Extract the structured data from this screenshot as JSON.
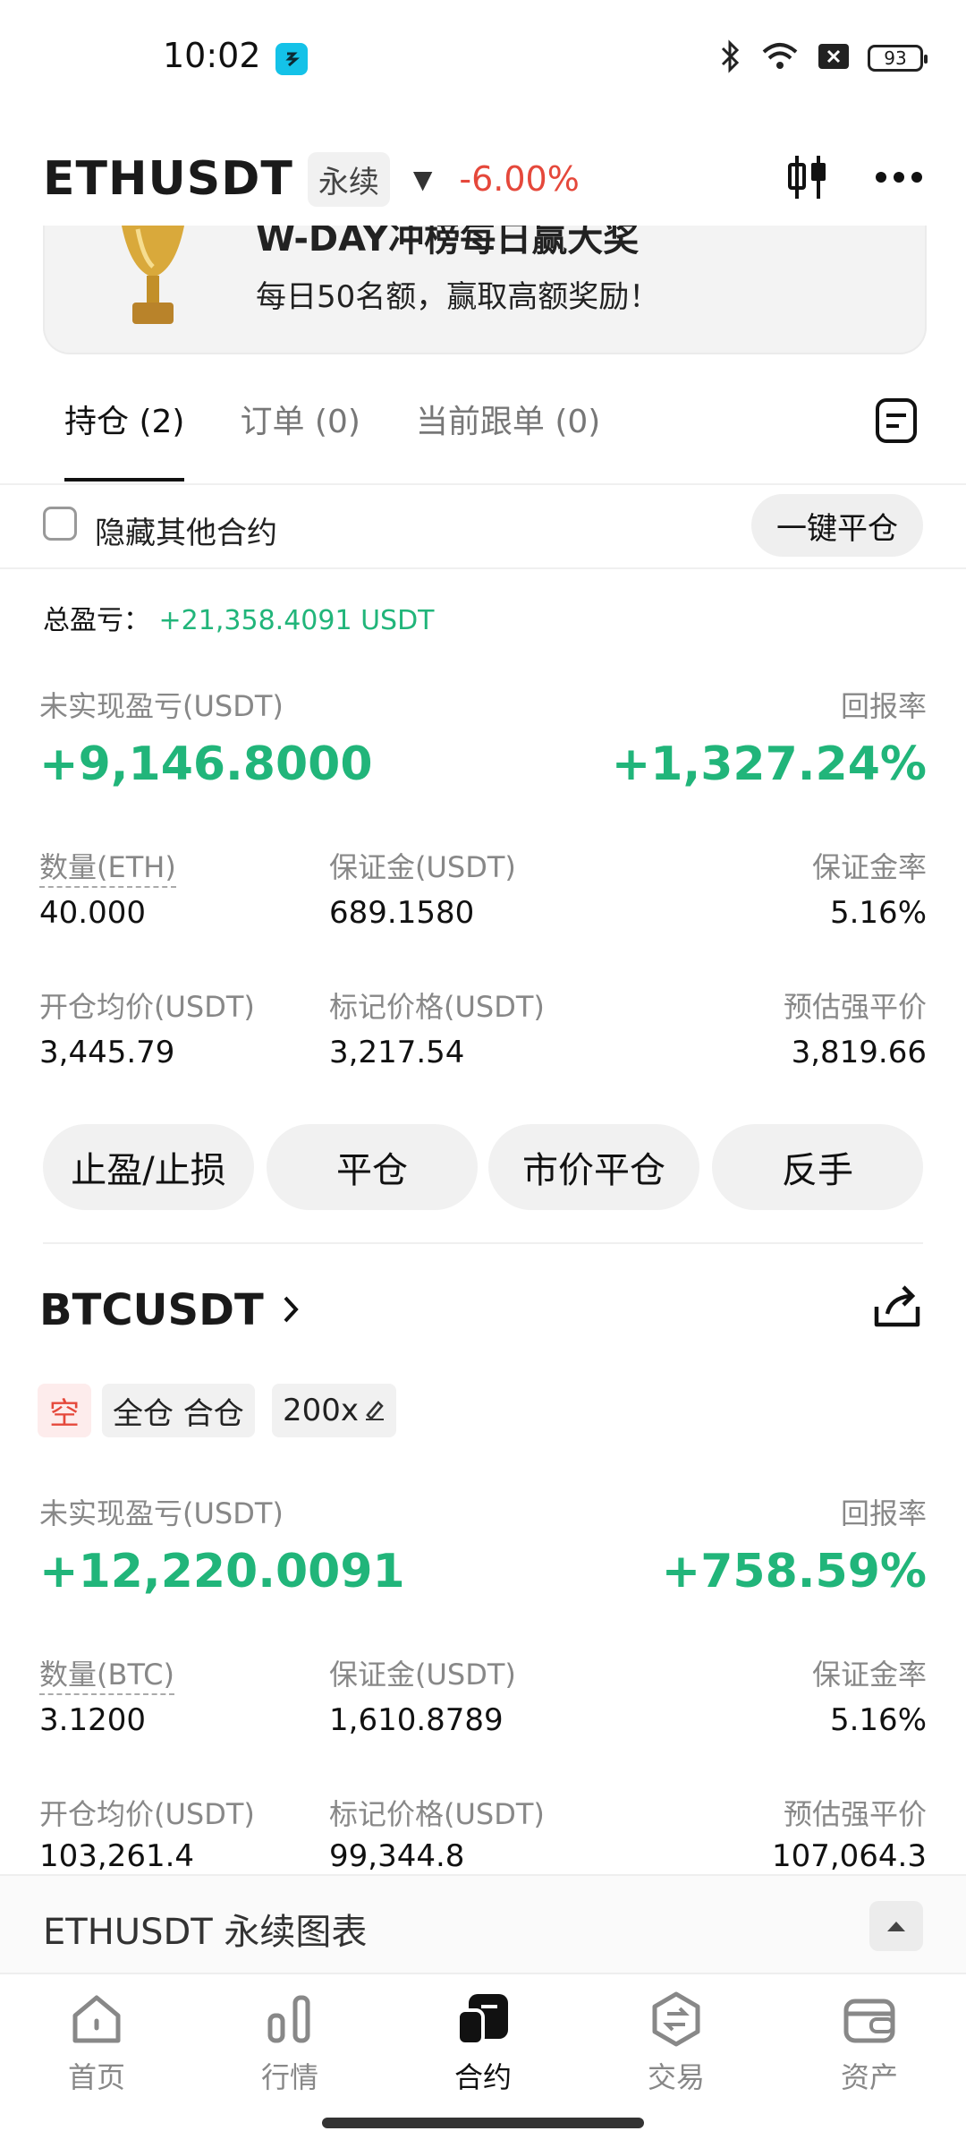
{
  "status_bar": {
    "time": "10:02",
    "battery": "93",
    "icons": [
      "bluetooth-icon",
      "wifi-icon",
      "close-box-icon",
      "battery-icon"
    ]
  },
  "header": {
    "symbol": "ETHUSDT",
    "contract_type": "永续",
    "change": "-6.00%",
    "change_color": "#e5483b"
  },
  "banner": {
    "title": "W-DAY冲榜每日赢大奖",
    "subtitle": "每日50名额，赢取高额奖励！"
  },
  "tabs": [
    {
      "label": "持仓 (2)",
      "active": true
    },
    {
      "label": "订单 (0)",
      "active": false
    },
    {
      "label": "当前跟单 (0)",
      "active": false
    }
  ],
  "filter": {
    "hide_others_label": "隐藏其他合约",
    "close_all_label": "一键平仓"
  },
  "total_pnl": {
    "label": "总盈亏：",
    "value": "+21,358.4091 USDT"
  },
  "positions": [
    {
      "symbol": "ETHUSDT",
      "unrealized_label": "未实现盈亏(USDT)",
      "unrealized_value": "+9,146.8000",
      "roe_label": "回报率",
      "roe_value": "+1,327.24%",
      "qty_label": "数量(ETH)",
      "qty_value": "40.000",
      "margin_label": "保证金(USDT)",
      "margin_value": "689.1580",
      "margin_rate_label": "保证金率",
      "margin_rate_value": "5.16%",
      "entry_label": "开仓均价(USDT)",
      "entry_value": "3,445.79",
      "mark_label": "标记价格(USDT)",
      "mark_value": "3,217.54",
      "liq_label": "预估强平价",
      "liq_value": "3,819.66",
      "actions": [
        "止盈/止损",
        "平仓",
        "市价平仓",
        "反手"
      ]
    },
    {
      "symbol": "BTCUSDT",
      "side": "空",
      "margin_mode": "全仓 合仓",
      "leverage": "200x",
      "unrealized_label": "未实现盈亏(USDT)",
      "unrealized_value": "+12,220.0091",
      "roe_label": "回报率",
      "roe_value": "+758.59%",
      "qty_label": "数量(BTC)",
      "qty_value": "3.1200",
      "margin_label": "保证金(USDT)",
      "margin_value": "1,610.8789",
      "margin_rate_label": "保证金率",
      "margin_rate_value": "5.16%",
      "entry_label": "开仓均价(USDT)",
      "entry_value": "103,261.4",
      "mark_label": "标记价格(USDT)",
      "mark_value": "99,344.8",
      "liq_label": "预估强平价",
      "liq_value": "107,064.3"
    }
  ],
  "chart_bar": {
    "label": "ETHUSDT 永续图表"
  },
  "bottom_nav": [
    {
      "label": "首页",
      "icon": "home-icon",
      "active": false
    },
    {
      "label": "行情",
      "icon": "market-icon",
      "active": false
    },
    {
      "label": "合约",
      "icon": "contract-icon",
      "active": true
    },
    {
      "label": "交易",
      "icon": "trade-icon",
      "active": false
    },
    {
      "label": "资产",
      "icon": "wallet-icon",
      "active": false
    }
  ],
  "colors": {
    "profit": "#21b57a",
    "loss": "#e5483b"
  }
}
